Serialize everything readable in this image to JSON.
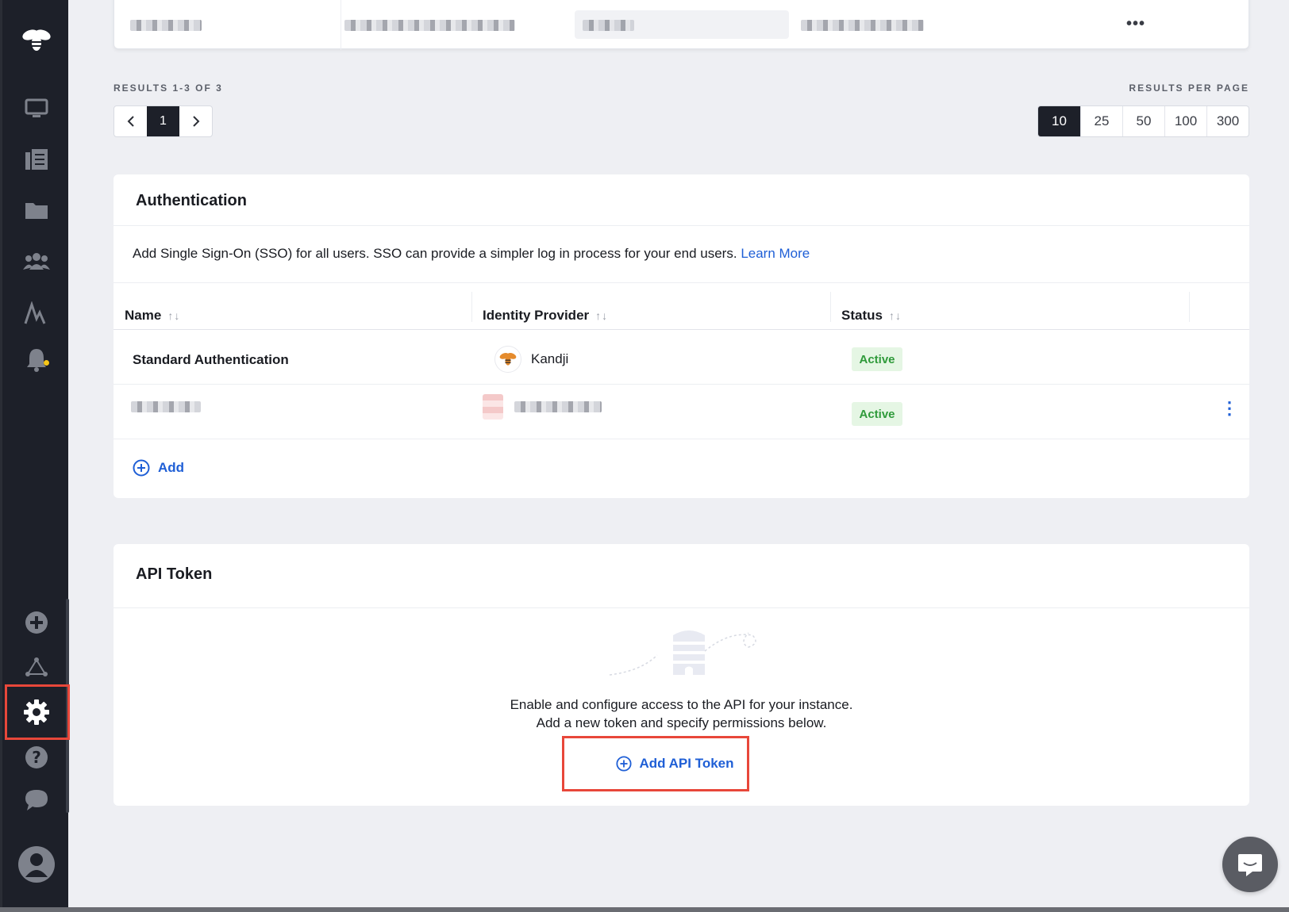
{
  "sidebar": {
    "items": [
      {
        "icon": "bee-logo-icon"
      },
      {
        "icon": "computer-icon"
      },
      {
        "icon": "library-icon"
      },
      {
        "icon": "folder-icon"
      },
      {
        "icon": "users-icon"
      },
      {
        "icon": "activity-icon"
      },
      {
        "icon": "bell-icon"
      },
      {
        "icon": "add-circle-icon"
      },
      {
        "icon": "integrations-icon"
      },
      {
        "icon": "gear-icon"
      },
      {
        "icon": "help-icon"
      },
      {
        "icon": "chat-icon"
      },
      {
        "icon": "avatar-icon"
      }
    ],
    "highlight_color": "#e8473a"
  },
  "pagination": {
    "results_label": "RESULTS 1-3 OF 3",
    "current_page": "1",
    "per_page_label": "RESULTS PER PAGE",
    "per_page_options": [
      "10",
      "25",
      "50",
      "100",
      "300"
    ],
    "selected_per_page": "10"
  },
  "authentication": {
    "title": "Authentication",
    "description": "Add Single Sign-On (SSO) for all users. SSO can provide a simpler log in process for your end users.",
    "learn_more": "Learn More",
    "columns": {
      "name": "Name",
      "identity_provider": "Identity Provider",
      "status": "Status"
    },
    "rows": [
      {
        "name": "Standard Authentication",
        "provider": "Kandji",
        "status": "Active"
      },
      {
        "name": "",
        "provider": "",
        "status": "Active"
      }
    ],
    "add_label": "Add"
  },
  "api_token": {
    "title": "API Token",
    "line1": "Enable and configure access to the API for your instance.",
    "line2": "Add a new token and specify permissions below.",
    "button_label": "Add API Token"
  },
  "colors": {
    "accent": "#1f5fd6",
    "sidebar_bg": "#1d2029",
    "active_badge_bg": "#e5f6e4",
    "active_badge_text": "#2f9a3a"
  }
}
